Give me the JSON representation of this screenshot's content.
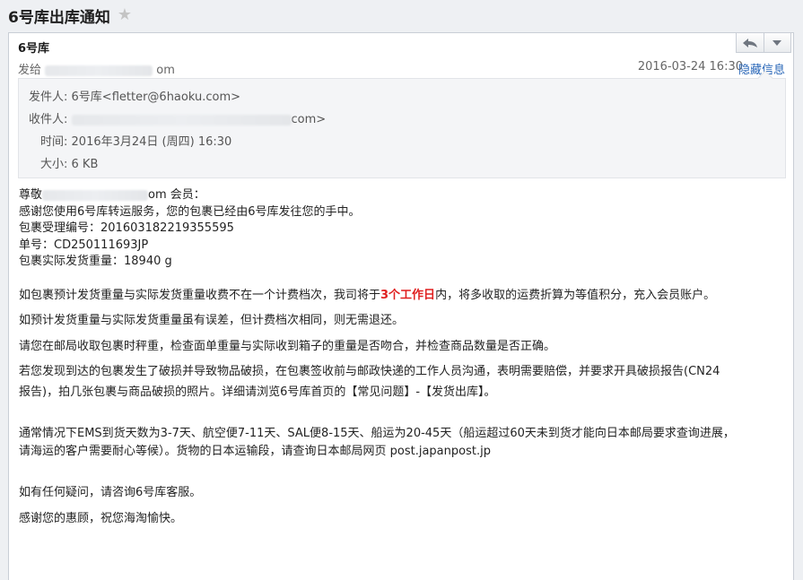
{
  "subject": "6号库出库通知",
  "sender": {
    "name": "6号库",
    "to_prefix": "发给",
    "to_suffix": "om",
    "datetime": "2016-03-24 16:30",
    "hide_details_label": "隐藏信息"
  },
  "details": {
    "from_label": "发件人:",
    "from_value": "6号库<fletter@6haoku.com>",
    "to_label": "收件人:",
    "to_suffix": "com>",
    "time_label": "时间:",
    "time_value": "2016年3月24日 (周四) 16:30",
    "size_label": "大小:",
    "size_value": "6 KB"
  },
  "body": {
    "greeting_prefix": "尊敬",
    "greeting_suffix": "om 会员：",
    "line_thanks": "感谢您使用6号库转运服务，您的包裹已经由6号库发往您的手中。",
    "line_receipt": "包裹受理编号：201603182219355595",
    "line_tracking": "单号：CD250111693JP",
    "line_weight": "包裹实际发货重量：18940 g",
    "p1_before": "如包裹预计发货重量与实际发货重量收费不在一个计费档次，我司将于",
    "p1_highlight": "3个工作日",
    "p1_after": "内，将多收取的运费折算为等值积分，充入会员账户。",
    "p2": "如预计发货重量与实际发货重量虽有误差，但计费档次相同，则无需退还。",
    "p3": "请您在邮局收取包裹时秤重，检查面单重量与实际收到箱子的重量是否吻合，并检查商品数量是否正确。",
    "p4_line1": "若您发现到达的包裹发生了破损并导致物品破损，在包裹签收前与邮政快递的工作人员沟通，表明需要赔偿，并要求开具破损报告(CN24",
    "p4_line2": "报告)，拍几张包裹与商品破损的照片。详细请浏览6号库首页的【常见问题】-【发货出库】。",
    "p5_line1": "通常情况下EMS到货天数为3-7天、航空便7-11天、SAL便8-15天、船运为20-45天（船运超过60天未到货才能向日本邮局要求查询进展，",
    "p5_line2": "请海运的客户需要耐心等候）。货物的日本运输段，请查询日本邮局网页 post.japanpost.jp",
    "p6": "如有任何疑问，请咨询6号库客服。",
    "p7": "感谢您的惠顾，祝您海淘愉快。"
  },
  "icons": {
    "star": "star-icon",
    "reply": "reply-icon",
    "more": "chevron-down-icon"
  },
  "colors": {
    "link": "#2a67b8",
    "highlight": "#e02020",
    "background": "#eef0f3"
  }
}
